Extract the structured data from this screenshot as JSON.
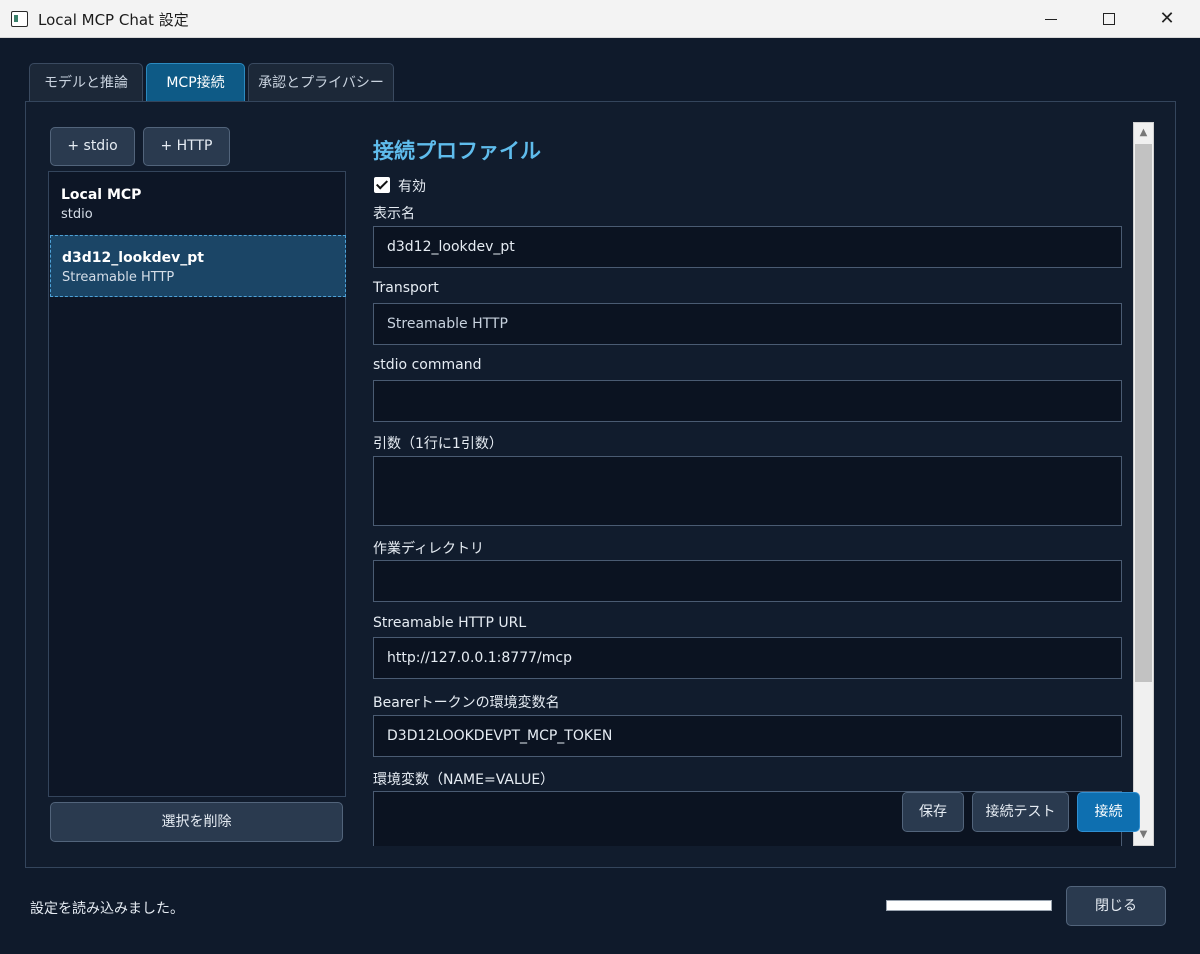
{
  "window": {
    "title": "Local MCP Chat 設定",
    "minimize_symbol": "",
    "maximize_symbol": "",
    "close_symbol": "✕"
  },
  "tabs": [
    {
      "label": "モデルと推論",
      "active": false
    },
    {
      "label": "MCP接続",
      "active": true
    },
    {
      "label": "承認とプライバシー",
      "active": false
    }
  ],
  "profiles": {
    "add_stdio_label": "+ stdio",
    "add_http_label": "+ HTTP",
    "items": [
      {
        "name": "Local MCP",
        "transport": "stdio",
        "selected": false
      },
      {
        "name": "d3d12_lookdev_pt",
        "transport": "Streamable HTTP",
        "selected": true
      }
    ],
    "delete_label": "選択を削除"
  },
  "form": {
    "title": "接続プロファイル",
    "enabled_label": "有効",
    "enabled_checked": true,
    "display_name_label": "表示名",
    "display_name_value": "d3d12_lookdev_pt",
    "transport_label": "Transport",
    "transport_value": "Streamable HTTP",
    "stdio_command_label": "stdio command",
    "stdio_command_value": "",
    "args_label": "引数（1行に1引数）",
    "args_value": "",
    "workdir_label": "作業ディレクトリ",
    "workdir_value": "",
    "url_label": "Streamable HTTP URL",
    "url_value": "http://127.0.0.1:8777/mcp",
    "token_env_label": "Bearerトークンの環境変数名",
    "token_env_value": "D3D12LOOKDEVPT_MCP_TOKEN",
    "env_label": "環境変数（NAME=VALUE）",
    "env_value": ""
  },
  "actions": {
    "save_label": "保存",
    "test_label": "接続テスト",
    "connect_label": "接続"
  },
  "status": {
    "message": "設定を読み込みました。",
    "close_label": "閉じる"
  },
  "icons": {
    "scroll_up": "▲",
    "scroll_down": "▼"
  }
}
